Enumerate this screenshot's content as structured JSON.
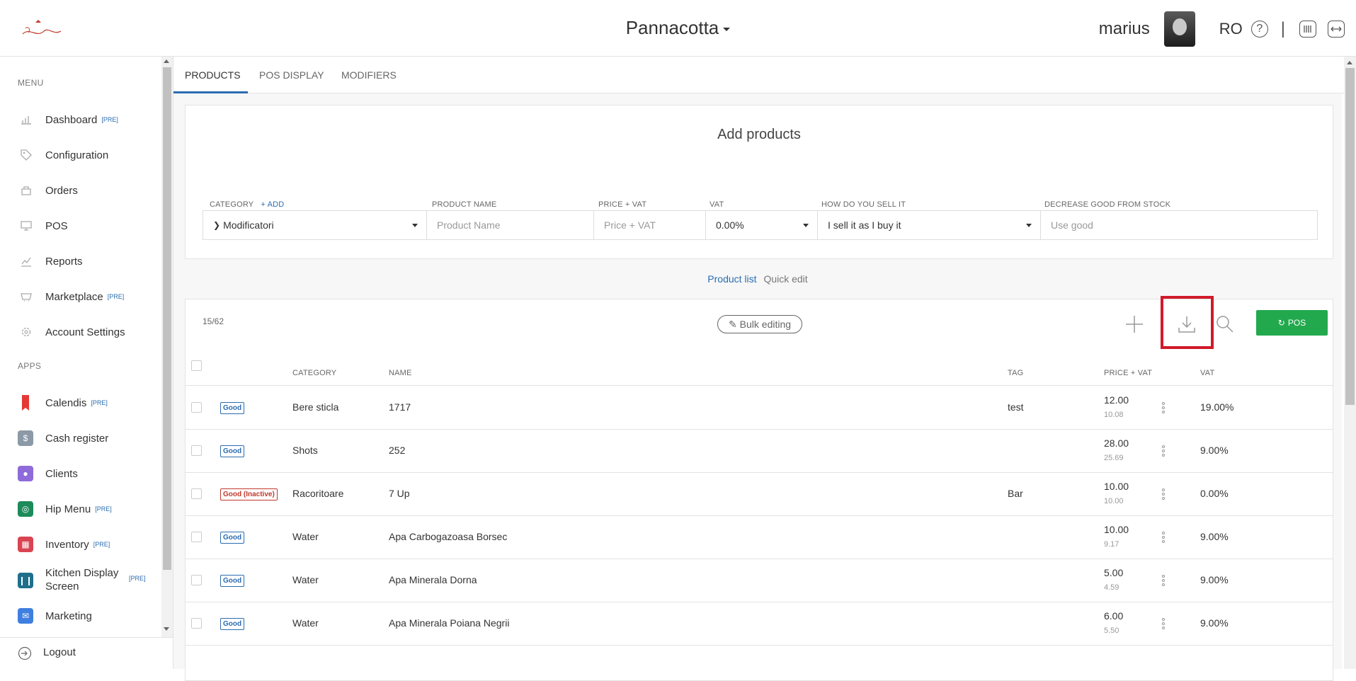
{
  "header": {
    "venue": "Pannacotta",
    "user_name": "marius",
    "lang": "RO",
    "help": "?",
    "separator": "|"
  },
  "sidebar": {
    "menu_label": "MENU",
    "apps_label": "APPS",
    "pre": "[PRE]",
    "menu": [
      {
        "label": "Dashboard",
        "icon": "chart-icon",
        "pre": true
      },
      {
        "label": "Configuration",
        "icon": "tag-icon",
        "pre": false
      },
      {
        "label": "Orders",
        "icon": "cart-icon",
        "pre": false
      },
      {
        "label": "POS",
        "icon": "monitor-icon",
        "pre": false
      },
      {
        "label": "Reports",
        "icon": "reports-icon",
        "pre": false
      },
      {
        "label": "Marketplace",
        "icon": "basket-icon",
        "pre": true
      },
      {
        "label": "Account Settings",
        "icon": "gear-icon",
        "pre": false
      }
    ],
    "apps": [
      {
        "label": "Calendis",
        "color": "#e53935",
        "pre": true
      },
      {
        "label": "Cash register",
        "color": "#8c99a6",
        "pre": false
      },
      {
        "label": "Clients",
        "color": "#8e6bd8",
        "pre": false
      },
      {
        "label": "Hip Menu",
        "color": "#1d8a5a",
        "pre": true
      },
      {
        "label": "Inventory",
        "color": "#d94452",
        "pre": true
      },
      {
        "label": "Kitchen Display Screen",
        "color": "#1f6f8b",
        "pre": true
      },
      {
        "label": "Marketing",
        "color": "#3f7fe0",
        "pre": false
      }
    ],
    "logout": "Logout"
  },
  "tabs": [
    "PRODUCTS",
    "POS DISPLAY",
    "MODIFIERS"
  ],
  "add_products": {
    "title": "Add products",
    "labels": {
      "category": "CATEGORY",
      "add": "+ ADD",
      "product_name": "PRODUCT NAME",
      "price_vat": "PRICE + VAT",
      "vat": "VAT",
      "how_sell": "HOW DO YOU SELL IT",
      "decrease": "DECREASE GOOD FROM STOCK"
    },
    "category_value": "Modificatori",
    "product_name_placeholder": "Product Name",
    "price_placeholder": "Price + VAT",
    "vat_value": "0.00%",
    "how_sell_value": "I sell it as I buy it",
    "decrease_placeholder": "Use good"
  },
  "view_switch": {
    "list": "Product list",
    "quick": "Quick edit"
  },
  "toolbar": {
    "count": "15/62",
    "bulk": "Bulk editing",
    "pos_button": "POS"
  },
  "table": {
    "headers": {
      "category": "CATEGORY",
      "name": "NAME",
      "tag": "TAG",
      "price": "PRICE + VAT",
      "vat": "VAT"
    },
    "rows": [
      {
        "badge": "Good",
        "inactive": false,
        "category": "Bere sticla",
        "name": "1717",
        "tag": "test",
        "price": "12.00",
        "net": "10.08",
        "vat": "19.00%"
      },
      {
        "badge": "Good",
        "inactive": false,
        "category": "Shots",
        "name": "252",
        "tag": "",
        "price": "28.00",
        "net": "25.69",
        "vat": "9.00%"
      },
      {
        "badge": "Good (Inactive)",
        "inactive": true,
        "category": "Racoritoare",
        "name": "7 Up",
        "tag": "Bar",
        "price": "10.00",
        "net": "10.00",
        "vat": "0.00%"
      },
      {
        "badge": "Good",
        "inactive": false,
        "category": "Water",
        "name": "Apa Carbogazoasa Borsec",
        "tag": "",
        "price": "10.00",
        "net": "9.17",
        "vat": "9.00%"
      },
      {
        "badge": "Good",
        "inactive": false,
        "category": "Water",
        "name": "Apa Minerala Dorna",
        "tag": "",
        "price": "5.00",
        "net": "4.59",
        "vat": "9.00%"
      },
      {
        "badge": "Good",
        "inactive": false,
        "category": "Water",
        "name": "Apa Minerala Poiana Negrii",
        "tag": "",
        "price": "6.00",
        "net": "5.50",
        "vat": "9.00%"
      }
    ]
  }
}
